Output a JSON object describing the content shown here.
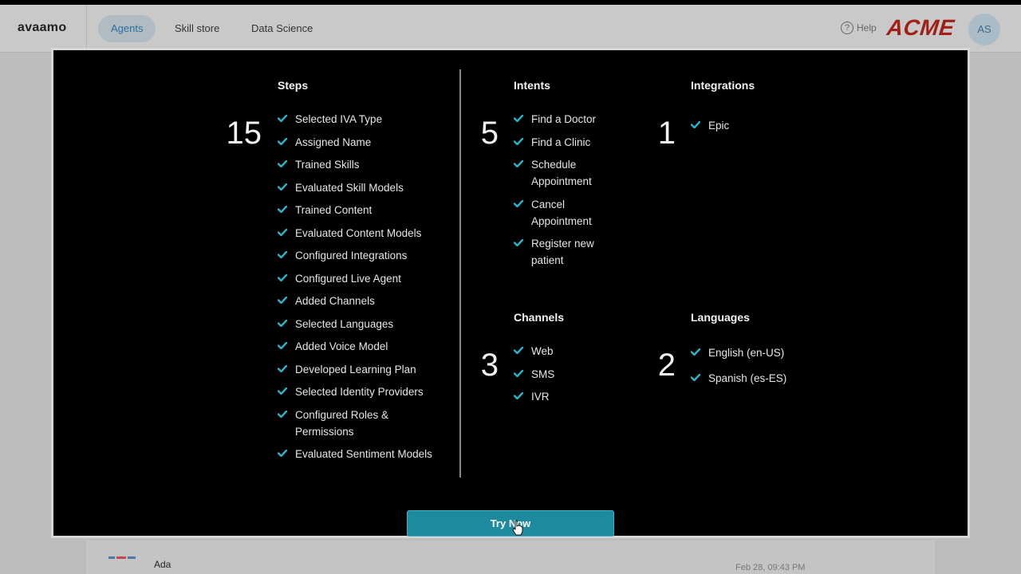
{
  "app": {
    "logo": "avaamo",
    "nav": [
      {
        "label": "Agents",
        "active": true
      },
      {
        "label": "Skill store",
        "active": false
      },
      {
        "label": "Data Science",
        "active": false
      }
    ],
    "help_label": "Help",
    "help_glyph": "?",
    "brand": "ACME",
    "avatar_initials": "AS",
    "row": {
      "name": "Ada",
      "date": "Feb 28, 09:43 PM"
    }
  },
  "modal": {
    "steps": {
      "title": "Steps",
      "count": "15",
      "items": [
        "Selected IVA Type",
        "Assigned Name",
        "Trained Skills",
        "Evaluated Skill Models",
        "Trained Content",
        "Evaluated Content Models",
        "Configured Integrations",
        "Configured Live Agent",
        "Added Channels",
        "Selected Languages",
        "Added Voice Model",
        "Developed Learning Plan",
        "Selected Identity Providers",
        "Configured Roles & Permissions",
        "Evaluated Sentiment Models"
      ]
    },
    "intents": {
      "title": "Intents",
      "count": "5",
      "items": [
        "Find a Doctor",
        "Find a Clinic",
        "Schedule Appointment",
        "Cancel Appointment",
        "Register new patient"
      ]
    },
    "integrations": {
      "title": "Integrations",
      "count": "1",
      "items": [
        "Epic"
      ]
    },
    "channels": {
      "title": "Channels",
      "count": "3",
      "items": [
        "Web",
        "SMS",
        "IVR"
      ]
    },
    "languages": {
      "title": "Languages",
      "count": "2",
      "items": [
        "English (en-US)",
        "Spanish (es-ES)"
      ]
    },
    "cta_label": "Try Now"
  },
  "colors": {
    "check": "#2bb3c8",
    "button": "#1e8aa0",
    "brand": "#a02018"
  },
  "icons": {
    "check": "check-icon",
    "help": "help-circle-icon",
    "cursor": "hand-pointer-icon"
  }
}
